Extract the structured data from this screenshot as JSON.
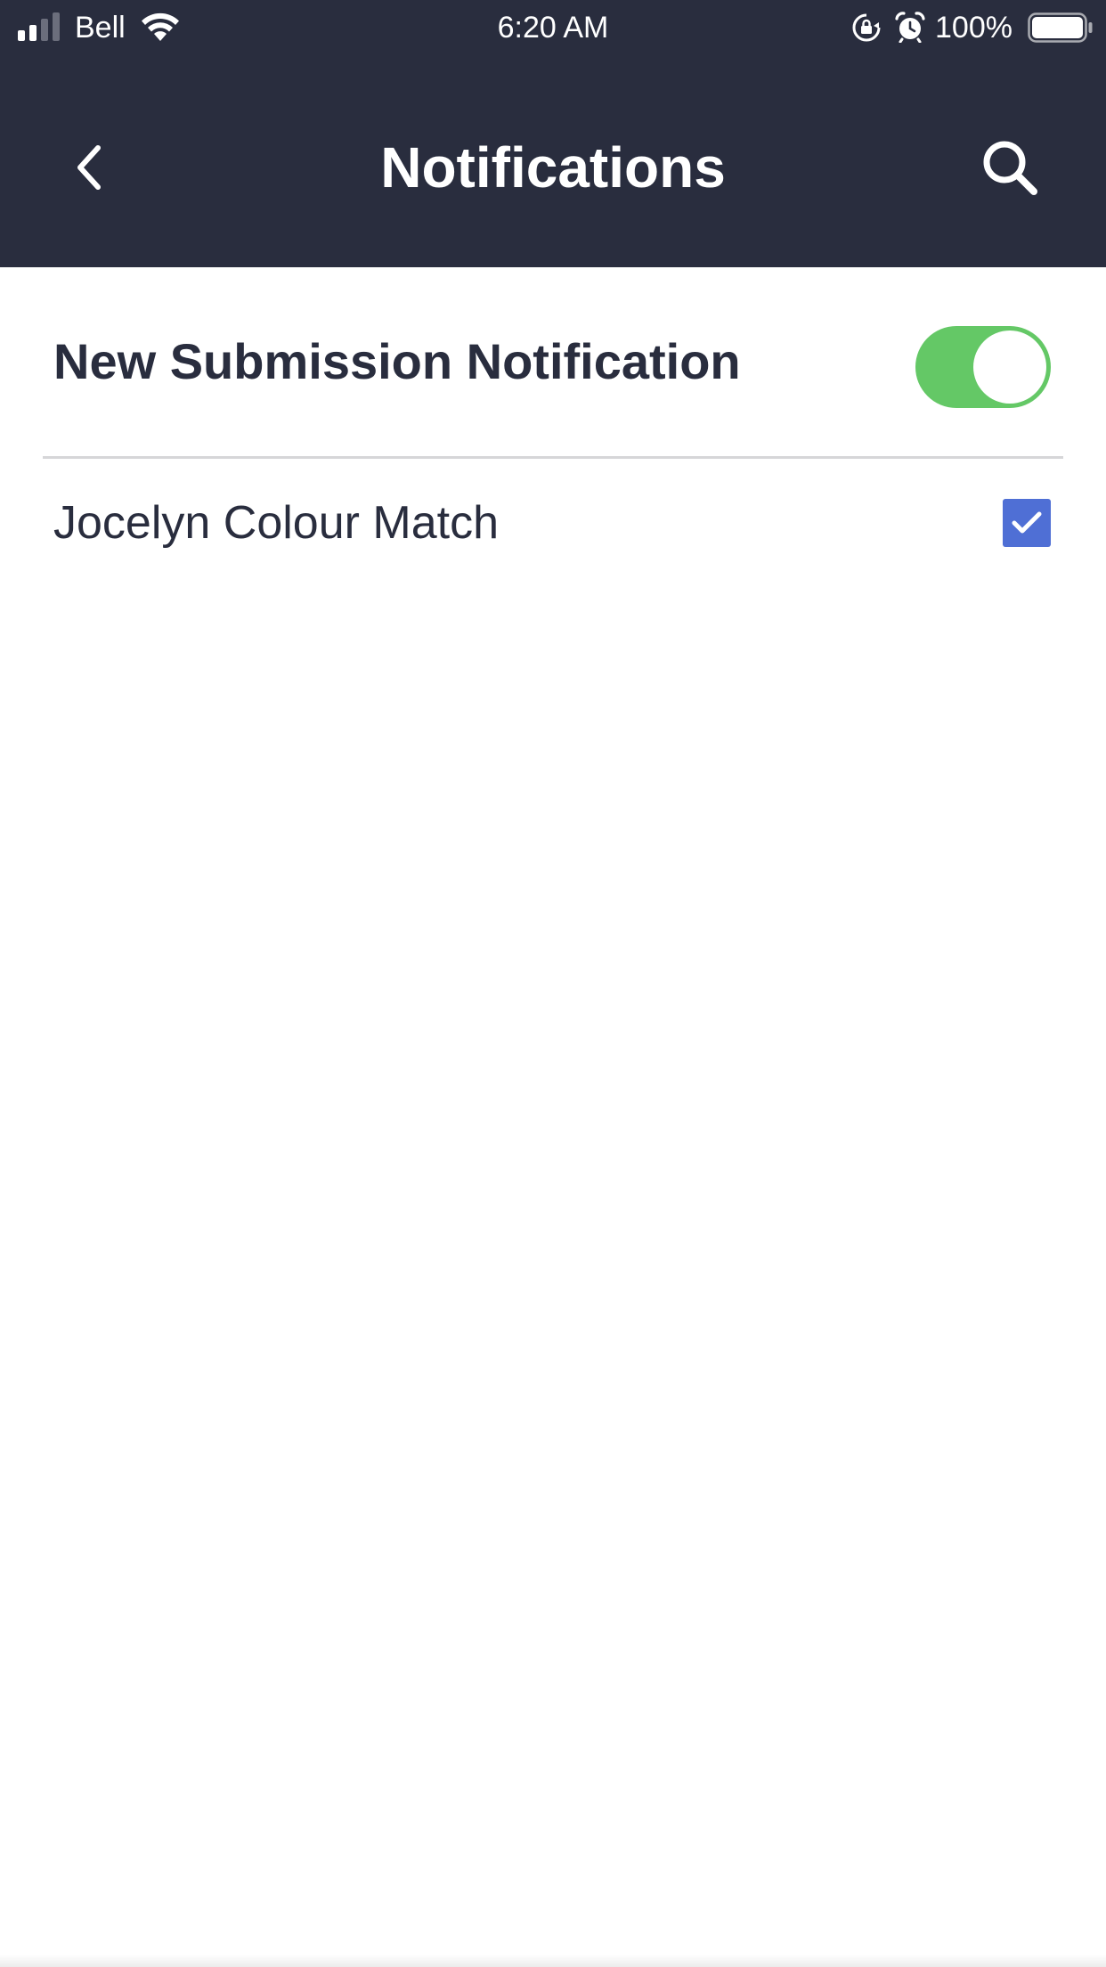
{
  "status_bar": {
    "carrier": "Bell",
    "time": "6:20 AM",
    "battery_percent": "100%",
    "signal_bars_filled": 2,
    "signal_bars_total": 4,
    "battery_level": 1.0,
    "icons": [
      "cellular-signal-icon",
      "wifi-icon",
      "rotation-lock-icon",
      "alarm-icon",
      "battery-icon"
    ]
  },
  "header": {
    "title": "Notifications",
    "back_icon": "chevron-left-icon",
    "search_icon": "search-icon"
  },
  "settings": {
    "new_submission": {
      "label": "New Submission Notification",
      "enabled": true
    },
    "forms": [
      {
        "label": "Jocelyn Colour Match",
        "checked": true
      }
    ]
  },
  "colors": {
    "header_bg": "#292d3e",
    "text": "#292d3e",
    "toggle_on": "#64c866",
    "checkbox": "#4f6fd5",
    "divider": "#d6d6d8"
  }
}
